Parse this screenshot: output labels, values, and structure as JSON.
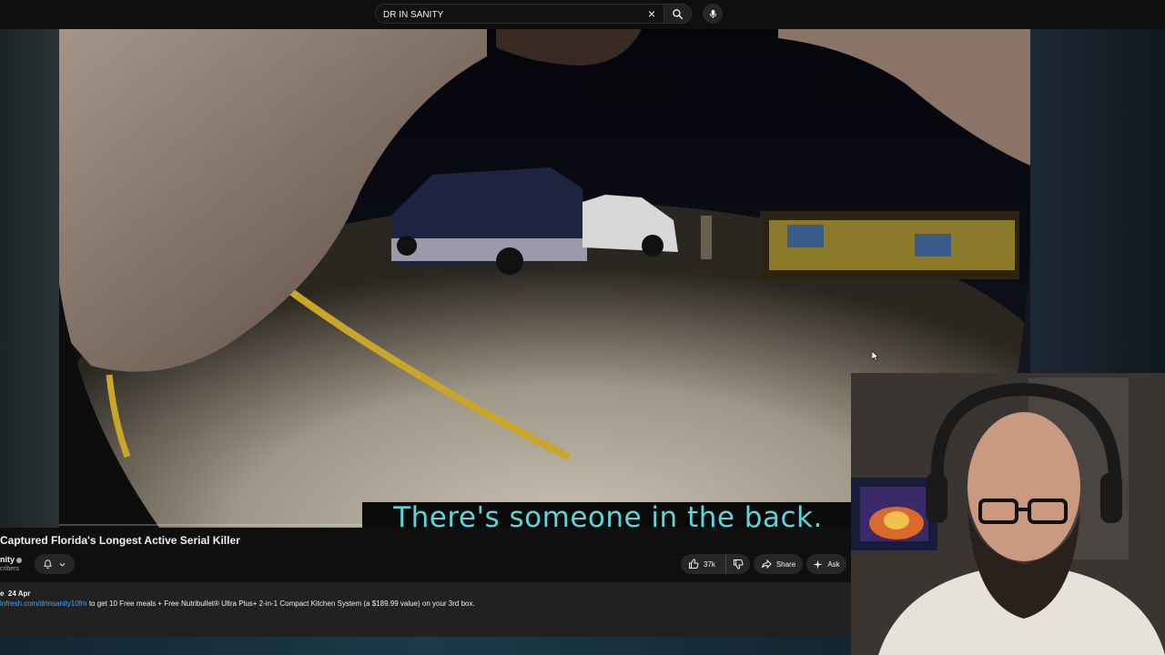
{
  "search": {
    "query": "DR IN SANITY",
    "clear_icon": "close-icon",
    "search_icon": "search-icon",
    "mic_icon": "mic-icon"
  },
  "video": {
    "subtitle": "There's someone in the back."
  },
  "info": {
    "title": "Captured Florida's Longest Active Serial Killer",
    "channel": "nity",
    "subscribers": "cribers",
    "like_count": "37k",
    "share_label": "Share",
    "ask_label": "Ask"
  },
  "description": {
    "meta_prefix": "e",
    "date": "24 Apr",
    "link": "lofresh.com/drinsanity10fm",
    "text": " to get 10 Free meals + Free Nutribullet® Ultra Plus+ 2-in-1 Compact Kitchen System (a $189.99 value) on your 3rd box."
  },
  "colors": {
    "background": "#0f0f0f",
    "pill": "#272727",
    "subtitle_text": "#5fd4d8",
    "link": "#3ea6ff"
  }
}
